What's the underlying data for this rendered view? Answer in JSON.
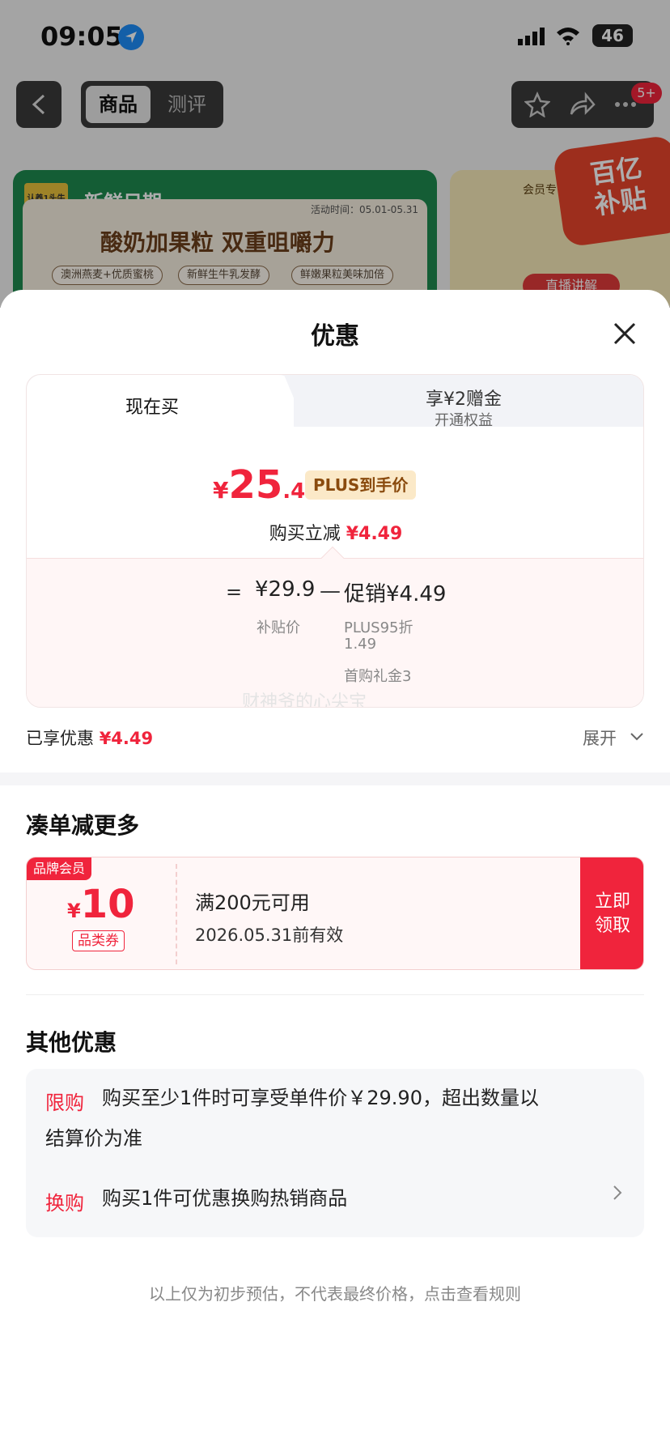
{
  "status_bar": {
    "time": "09:05",
    "battery": "46"
  },
  "nav": {
    "tabs": [
      "商品",
      "测评"
    ],
    "badge": "5+"
  },
  "banner": {
    "brand": "认养1头牛",
    "label": "新鲜日期",
    "date": "活动时间：05.01-05.31",
    "title": "酸奶加果粒 双重咀嚼力",
    "tags": [
      "澳洲燕麦+优质蜜桃",
      "新鲜生牛乳发酵",
      "鲜嫩果粒美味加倍"
    ]
  },
  "side_card": {
    "title": "会员专",
    "button": "直播讲解"
  },
  "sticker": {
    "text": "百亿补贴"
  },
  "sheet": {
    "title": "优惠",
    "tabs": {
      "now": "现在买",
      "gift": "享¥2赠金",
      "gift_sub": "开通权益"
    },
    "price": {
      "yen": "¥",
      "int": "25",
      "dec": ".41"
    },
    "plus_badge": "PLUS到手价",
    "reduce_label": "购买立减",
    "reduce_amount": "¥4.49",
    "breakdown": {
      "eq": "=",
      "subsidy_price": "¥29.9",
      "minus": "—",
      "promo": "促销¥4.49",
      "subsidy_label": "补贴价",
      "promo_l1": "PLUS95折",
      "promo_l2": "1.49",
      "promo_l3": "首购礼金3"
    },
    "watermark": "财神爷的心尖宝",
    "enjoyed_label": "已享优惠",
    "enjoyed_amount": "¥4.49",
    "expand": "展开"
  },
  "more": {
    "title": "凑单减更多",
    "coupon": {
      "tag": "品牌会员",
      "yen": "¥",
      "value": "10",
      "type": "品类券",
      "condition": "满200元可用",
      "expiry": "2026.05.31前有效",
      "button": "立即领取"
    }
  },
  "other": {
    "title": "其他优惠",
    "items": [
      {
        "tag": "限购",
        "text1": "购买至少1件时可享受单件价￥29.90，超出数量以",
        "text2": "结算价为准"
      },
      {
        "tag": "换购",
        "text1": "购买1件可优惠换购热销商品"
      }
    ]
  },
  "footer": "以上仅为初步预估，不代表最终价格，点击查看规则",
  "colors": {
    "accent": "#f0243c",
    "plus_bg": "#fbe9c8"
  }
}
